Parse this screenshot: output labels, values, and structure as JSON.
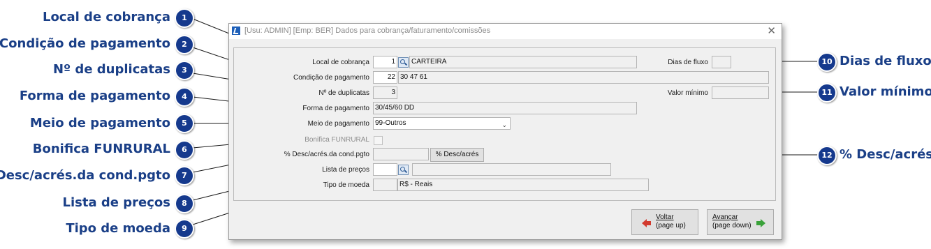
{
  "window": {
    "title": "[Usu: ADMIN] [Emp: BER] Dados para cobrança/faturamento/comissões",
    "close_glyph": "✕"
  },
  "callouts": [
    {
      "num": "1",
      "text": "Local de cobrança"
    },
    {
      "num": "2",
      "text": "Condição de pagamento"
    },
    {
      "num": "3",
      "text": "Nº de duplicatas"
    },
    {
      "num": "4",
      "text": "Forma de pagamento"
    },
    {
      "num": "5",
      "text": "Meio de pagamento"
    },
    {
      "num": "6",
      "text": "Bonifica FUNRURAL"
    },
    {
      "num": "7",
      "text": "% Desc/acrés.da cond.pgto"
    },
    {
      "num": "8",
      "text": "Lista de preços"
    },
    {
      "num": "9",
      "text": "Tipo de moeda"
    },
    {
      "num": "10",
      "text": "Dias de fluxo"
    },
    {
      "num": "11",
      "text": "Valor mínimo"
    },
    {
      "num": "12",
      "text": "% Desc/acrés"
    }
  ],
  "form": {
    "local_cobranca": {
      "label": "Local de cobrança",
      "code": "1",
      "desc": "CARTEIRA"
    },
    "condicao_pagamento": {
      "label": "Condição de pagamento",
      "code": "22",
      "desc": "30 47 61"
    },
    "num_duplicatas": {
      "label": "Nº de duplicatas",
      "value": "3"
    },
    "forma_pagamento": {
      "label": "Forma de pagamento",
      "value": "30/45/60 DD"
    },
    "meio_pagamento": {
      "label": "Meio de pagamento",
      "value": "99-Outros"
    },
    "bonifica_funrural": {
      "label": "Bonifica FUNRURAL",
      "checked": false
    },
    "desc_acres_cond": {
      "label": "% Desc/acrés.da cond.pgto",
      "value": "",
      "button": "% Desc/acrés"
    },
    "lista_precos": {
      "label": "Lista de preços",
      "code": "",
      "desc": ""
    },
    "tipo_moeda": {
      "label": "Tipo de moeda",
      "code": "",
      "desc": "R$  - Reais"
    },
    "dias_fluxo": {
      "label": "Dias de fluxo",
      "value": ""
    },
    "valor_minimo": {
      "label": "Valor mínimo",
      "value": ""
    }
  },
  "buttons": {
    "voltar": {
      "label": "Voltar",
      "sub": "(page up)"
    },
    "avancar": {
      "label": "Avançar",
      "sub": "(page down)"
    }
  },
  "icons": {
    "lookup": "magnifier-icon",
    "back": "arrow-left-icon",
    "forward": "arrow-right-icon"
  },
  "colors": {
    "callout": "#1a3f87",
    "badge": "#15398d",
    "back_arrow": "#d23a2e",
    "forward_arrow": "#3aa23a"
  }
}
